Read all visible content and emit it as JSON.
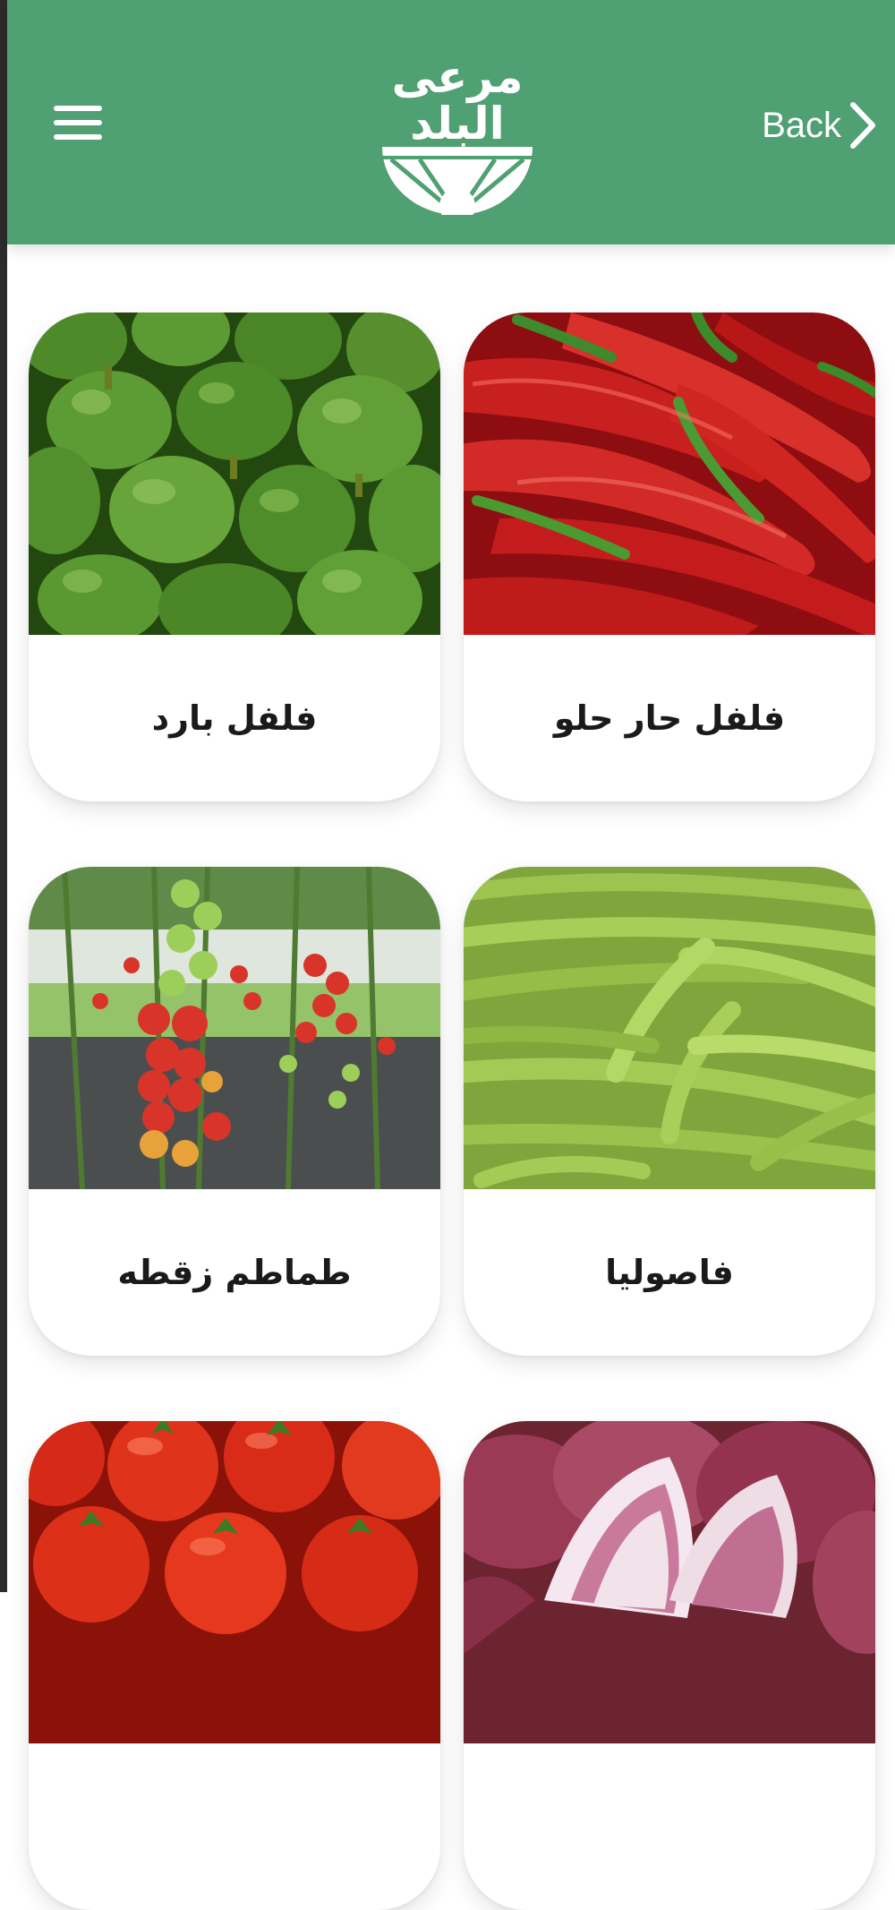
{
  "header": {
    "back_label": "Back",
    "logo_line1": "مرعى",
    "logo_line2": "البلد"
  },
  "products": [
    {
      "name": "فلفل حار حلو",
      "image": "red-chili-peppers"
    },
    {
      "name": "فلفل بارد",
      "image": "green-bell-peppers"
    },
    {
      "name": "فاصوليا",
      "image": "green-beans"
    },
    {
      "name": "طماطم زقطه",
      "image": "cherry-tomato-plants"
    },
    {
      "name": "",
      "image": "red-onions"
    },
    {
      "name": "",
      "image": "tomatoes"
    }
  ],
  "colors": {
    "header": "#4fa072",
    "card_bg": "#ffffff",
    "text": "#1a1a1a"
  }
}
